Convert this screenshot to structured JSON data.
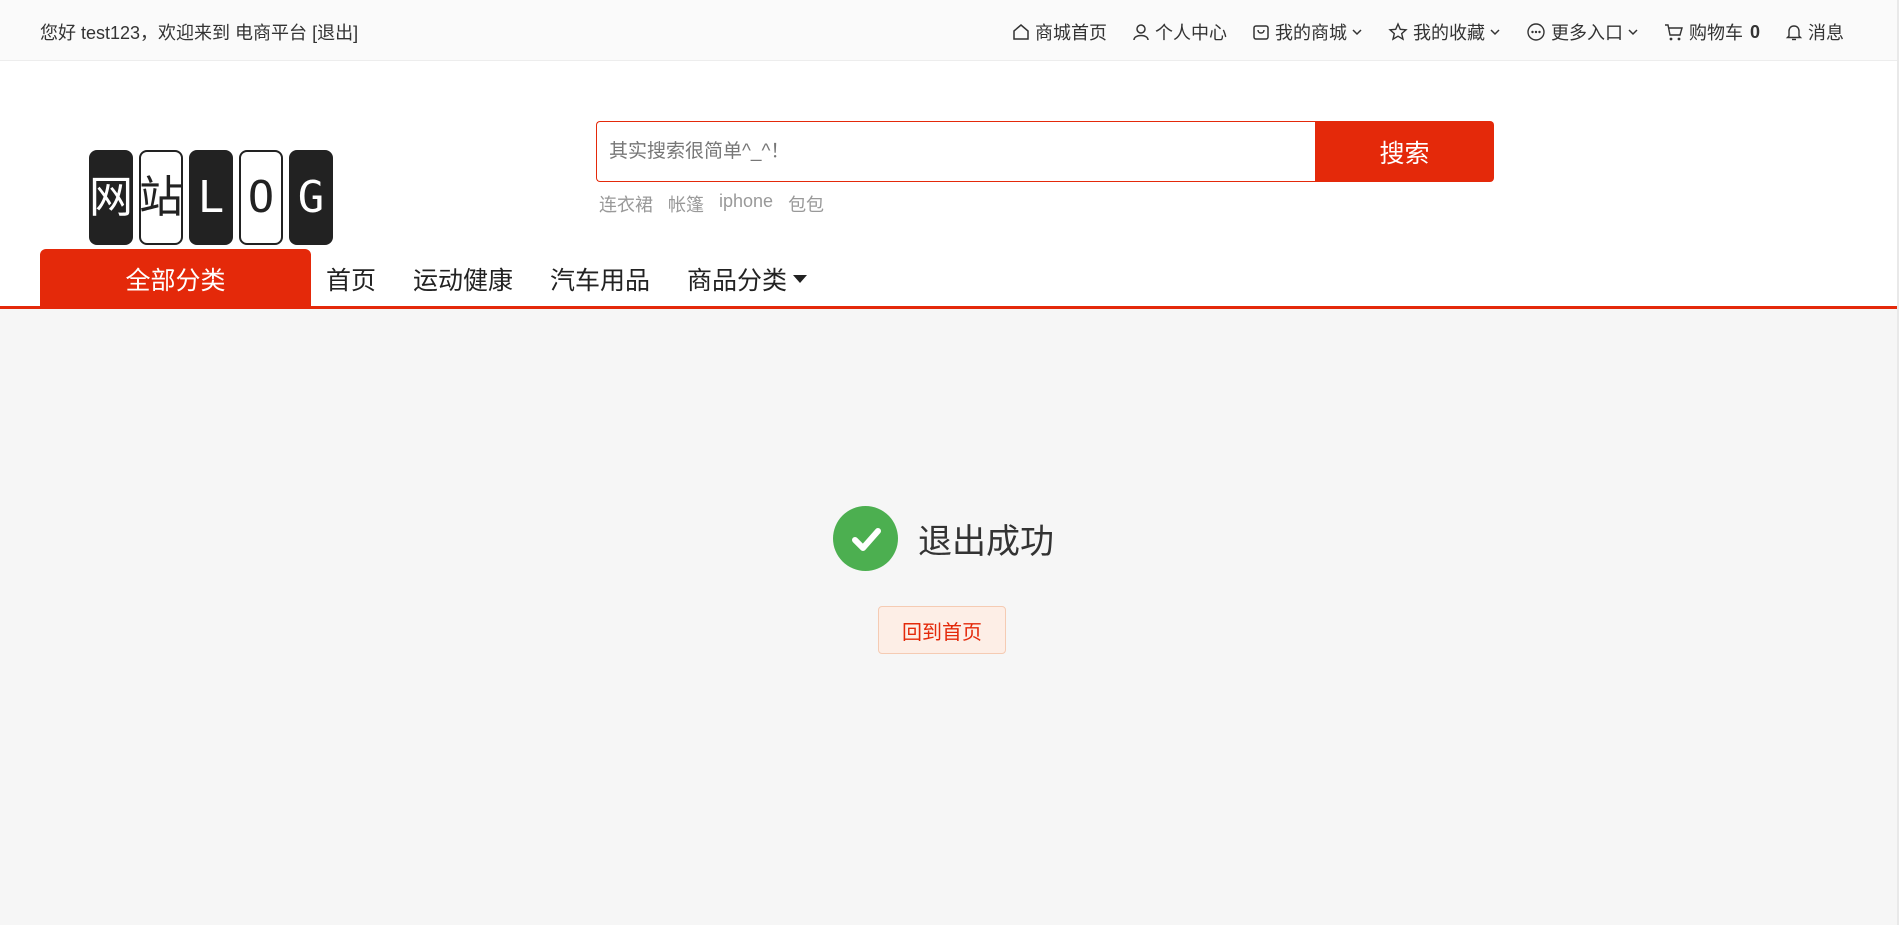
{
  "topbar": {
    "greeting_prefix": "您好 test123，欢迎来到 电商平台",
    "logout_label": "[退出]",
    "nav": {
      "home": "商城首页",
      "profile": "个人中心",
      "my_store": "我的商城",
      "favorites": "我的收藏",
      "more": "更多入口",
      "cart": "购物车",
      "cart_count": "0",
      "messages": "消息"
    }
  },
  "logo": {
    "text": [
      "网",
      "站",
      "L",
      "O",
      "G"
    ]
  },
  "search": {
    "placeholder": "其实搜索很简单^_^！",
    "button_label": "搜索",
    "hotwords": [
      "连衣裙",
      "帐篷",
      "iphone",
      "包包"
    ]
  },
  "mainnav": {
    "all_categories": "全部分类",
    "links": [
      "首页",
      "运动健康",
      "汽车用品",
      "商品分类"
    ]
  },
  "result": {
    "message": "退出成功",
    "home_button": "回到首页"
  },
  "colors": {
    "accent": "#e4290a",
    "success": "#4caf50"
  }
}
